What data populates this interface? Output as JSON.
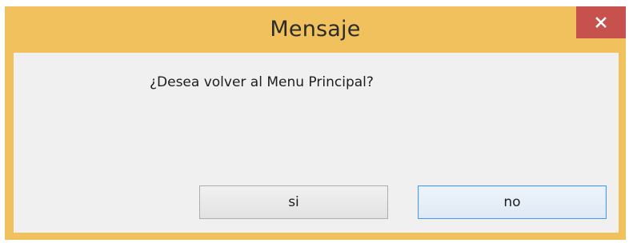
{
  "window": {
    "title": "Mensaje",
    "close_icon": "close-icon"
  },
  "dialog": {
    "message": "¿Desea volver al Menu Principal?",
    "buttons": {
      "yes_label": "si",
      "no_label": "no"
    }
  },
  "colors": {
    "titlebar": "#f0c15c",
    "close_button": "#c7514d",
    "client_area": "#f0f0f0",
    "focused_button_border": "#4f9ae5"
  }
}
